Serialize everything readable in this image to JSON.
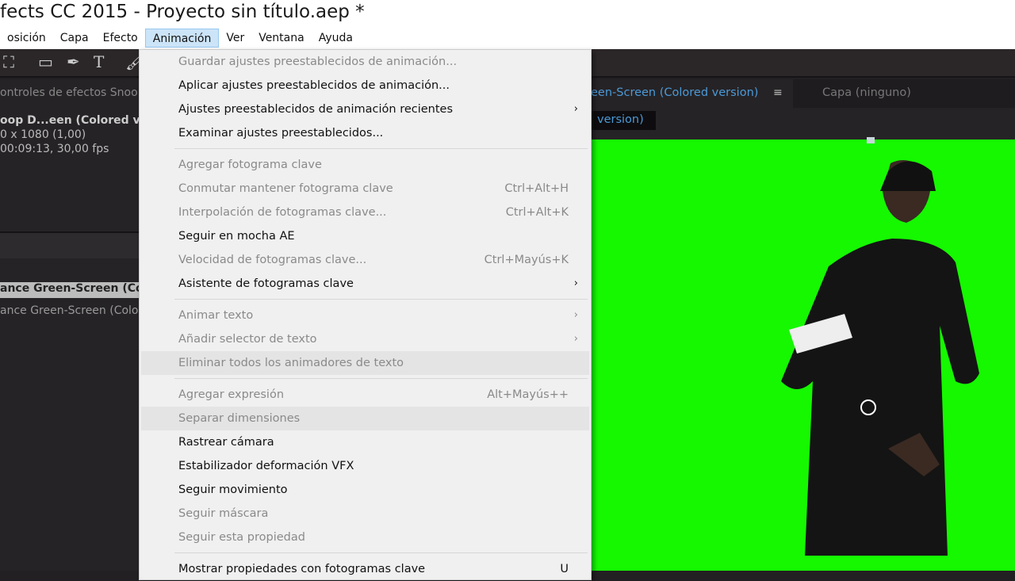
{
  "title": "fects CC 2015 - Proyecto sin título.aep *",
  "menubar": [
    "osición",
    "Capa",
    "Efecto",
    "Animación",
    "Ver",
    "Ventana",
    "Ayuda"
  ],
  "left_panel": {
    "tab": "ontroles de efectos  Snoo",
    "comp_name": "oop D...een (Colored ver",
    "dims": "0 x 1080 (1,00)",
    "duration": "00:09:13, 30,00 fps",
    "item_selected": "ance Green-Screen (Co",
    "item": "ance Green-Screen (Colore"
  },
  "viewer": {
    "tab": "een-Screen (Colored version)",
    "menu_icon": "≡",
    "layer_tab": "Capa (ninguno)",
    "comp_label": "version)"
  },
  "menu": [
    {
      "label": "Guardar ajustes preestablecidos de animación...",
      "disabled": true
    },
    {
      "label": "Aplicar ajustes preestablecidos de animación..."
    },
    {
      "label": "Ajustes preestablecidos de animación recientes",
      "submenu": true
    },
    {
      "label": "Examinar ajustes preestablecidos..."
    },
    {
      "sep": true
    },
    {
      "label": "Agregar fotograma clave",
      "disabled": true
    },
    {
      "label": "Conmutar mantener fotograma clave",
      "shortcut": "Ctrl+Alt+H",
      "disabled": true
    },
    {
      "label": "Interpolación de fotogramas clave...",
      "shortcut": "Ctrl+Alt+K",
      "disabled": true
    },
    {
      "label": "Seguir en mocha AE"
    },
    {
      "label": "Velocidad de fotogramas clave...",
      "shortcut": "Ctrl+Mayús+K",
      "disabled": true
    },
    {
      "label": "Asistente de fotogramas clave",
      "submenu": true
    },
    {
      "sep": true
    },
    {
      "label": "Animar texto",
      "submenu": true,
      "disabled": true
    },
    {
      "label": "Añadir selector de texto",
      "submenu": true,
      "disabled": true
    },
    {
      "label": "Eliminar todos los animadores de texto",
      "disabled": true,
      "hl": true
    },
    {
      "sep": true
    },
    {
      "label": "Agregar expresión",
      "shortcut": "Alt+Mayús++",
      "disabled": true
    },
    {
      "label": "Separar dimensiones",
      "disabled": true,
      "hl": true
    },
    {
      "label": "Rastrear cámara"
    },
    {
      "label": "Estabilizador deformación VFX"
    },
    {
      "label": "Seguir movimiento"
    },
    {
      "label": "Seguir máscara",
      "disabled": true
    },
    {
      "label": "Seguir esta propiedad",
      "disabled": true
    },
    {
      "sep": true
    },
    {
      "label": "Mostrar propiedades con fotogramas clave",
      "shortcut": "U"
    }
  ]
}
